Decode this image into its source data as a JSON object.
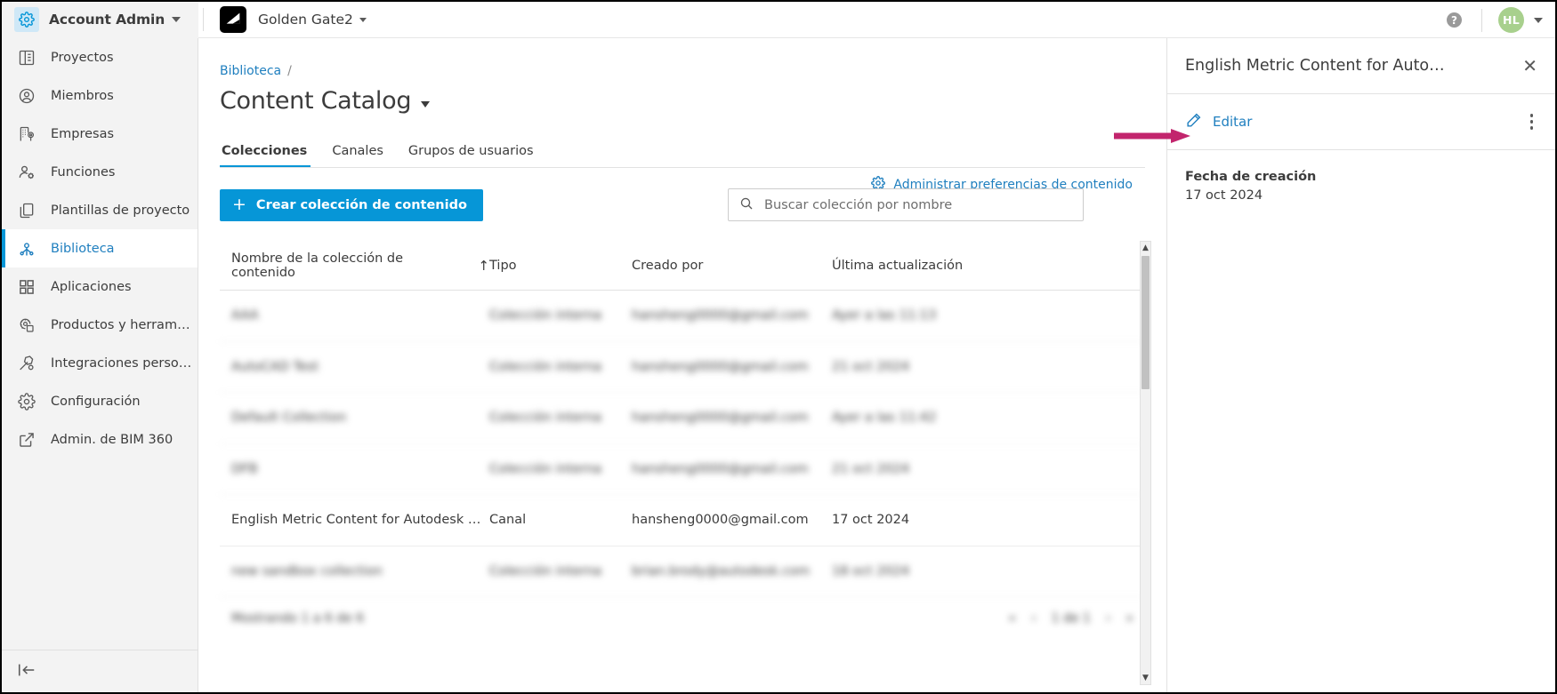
{
  "topbar": {
    "gear_icon": "gear-icon",
    "account_label": "Account Admin",
    "project_logo": "autodesk-logo",
    "project_label": "Golden Gate2",
    "help_icon": "help-icon",
    "help_glyph": "?",
    "avatar_initials": "HL",
    "accent_color": "#0696d7"
  },
  "sidebar": {
    "items": [
      {
        "label": "Proyectos",
        "icon": "projects-icon",
        "active": false
      },
      {
        "label": "Miembros",
        "icon": "members-icon",
        "active": false
      },
      {
        "label": "Empresas",
        "icon": "companies-icon",
        "active": false
      },
      {
        "label": "Funciones",
        "icon": "roles-icon",
        "active": false
      },
      {
        "label": "Plantillas de proyecto",
        "icon": "templates-icon",
        "active": false
      },
      {
        "label": "Biblioteca",
        "icon": "library-icon",
        "active": true
      },
      {
        "label": "Aplicaciones",
        "icon": "apps-icon",
        "active": false
      },
      {
        "label": "Productos y herramien…",
        "icon": "products-icon",
        "active": false
      },
      {
        "label": "Integraciones persona…",
        "icon": "integrations-icon",
        "active": false
      },
      {
        "label": "Configuración",
        "icon": "settings-icon",
        "active": false
      },
      {
        "label": "Admin. de BIM 360",
        "icon": "external-link-icon",
        "active": false
      }
    ],
    "collapse_icon": "collapse-sidebar-icon"
  },
  "main": {
    "breadcrumb": {
      "root": "Biblioteca",
      "separator": "/"
    },
    "page_title": "Content Catalog",
    "tabs": [
      {
        "label": "Colecciones",
        "active": true
      },
      {
        "label": "Canales",
        "active": false
      },
      {
        "label": "Grupos de usuarios",
        "active": false
      }
    ],
    "prefs_link": "Administrar preferencias de contenido",
    "create_button": "Crear colección de contenido",
    "create_button_plus": "+",
    "search_placeholder": "Buscar colección por nombre",
    "search_value": "",
    "search_icon": "search-icon",
    "table": {
      "columns": [
        "Nombre de la colección de contenido",
        "Tipo",
        "Creado por",
        "Última actualización"
      ],
      "sort_column": "Nombre de la colección de contenido",
      "sort_arrow": "↑",
      "rows": [
        {
          "name": "AAA",
          "type": "Colección interna",
          "created_by": "hansheng0000@gmail.com",
          "updated": "Ayer a las 11:13",
          "redacted": true
        },
        {
          "name": "AutoCAD Test",
          "type": "Colección interna",
          "created_by": "hansheng0000@gmail.com",
          "updated": "21 oct 2024",
          "redacted": true
        },
        {
          "name": "Default Collection",
          "type": "Colección interna",
          "created_by": "hansheng0000@gmail.com",
          "updated": "Ayer a las 11:42",
          "redacted": true
        },
        {
          "name": "DFB",
          "type": "Colección interna",
          "created_by": "hansheng0000@gmail.com",
          "updated": "21 oct 2024",
          "redacted": true
        },
        {
          "name": "English Metric Content for Autodesk Re…",
          "type": "Canal",
          "created_by": "hansheng0000@gmail.com",
          "updated": "17 oct 2024",
          "redacted": false
        },
        {
          "name": "new sandbox collection",
          "type": "Colección interna",
          "created_by": "brian.brody@autodesk.com",
          "updated": "18 oct 2024",
          "redacted": true
        }
      ],
      "footer_text": "Mostrando 1 a 6 de 6",
      "pager": [
        "«",
        "‹",
        "1 de 1",
        "›",
        "»"
      ]
    }
  },
  "right_panel": {
    "title": "English Metric Content for Auto…",
    "close_icon": "close-icon",
    "edit_label": "Editar",
    "edit_icon": "pencil-icon",
    "kebab_icon": "more-options-icon",
    "fields": [
      {
        "label": "Fecha de creación",
        "value": "17 oct 2024"
      }
    ]
  },
  "annotation": {
    "arrow_color": "#c2256d",
    "arrow_name": "pointer-arrow"
  }
}
